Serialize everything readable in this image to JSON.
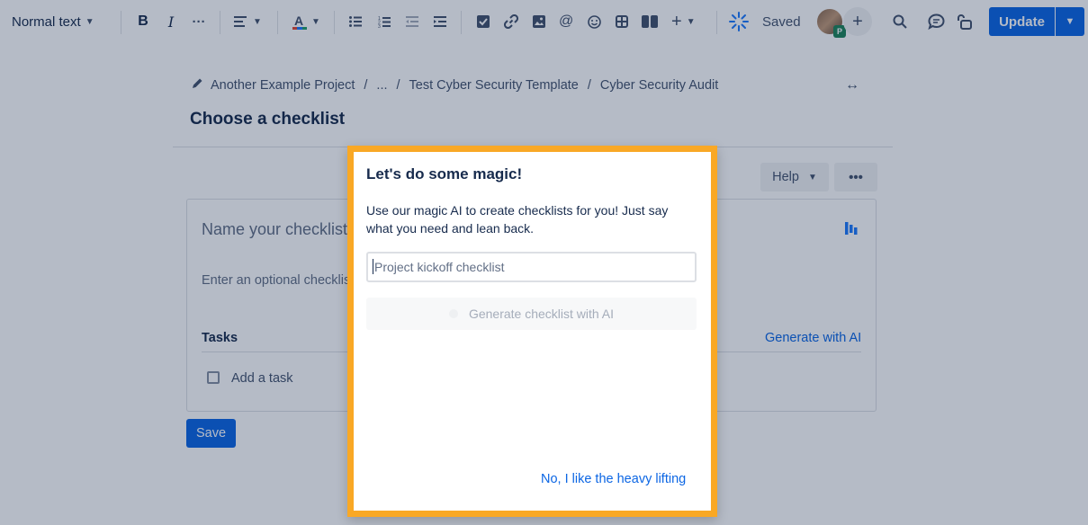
{
  "toolbar": {
    "text_style": "Normal text",
    "saved_label": "Saved",
    "update_label": "Update",
    "avatar_badge": "P"
  },
  "breadcrumb": {
    "items": [
      "Another Example Project",
      "...",
      "Test Cyber Security Template",
      "Cyber Security Audit"
    ],
    "separator": "/"
  },
  "page": {
    "title": "Choose a checklist",
    "help_label": "Help",
    "more_label": "•••"
  },
  "checklist": {
    "name_placeholder": "Name your checklist",
    "description_placeholder": "Enter an optional checklist",
    "tasks_label": "Tasks",
    "generate_ai_link": "Generate with AI",
    "add_task_label": "Add a task",
    "save_label": "Save"
  },
  "modal": {
    "title": "Let's do some magic!",
    "description": "Use our magic AI to create checklists for you! Just say what you need and lean back.",
    "input_placeholder": "Project kickoff checklist",
    "input_value": "",
    "generate_button": "Generate checklist with AI",
    "decline_link": "No, I like the heavy lifting"
  },
  "colors": {
    "primary": "#0c66e4",
    "highlight_border": "#f9a825",
    "overlay": "#091e42"
  }
}
